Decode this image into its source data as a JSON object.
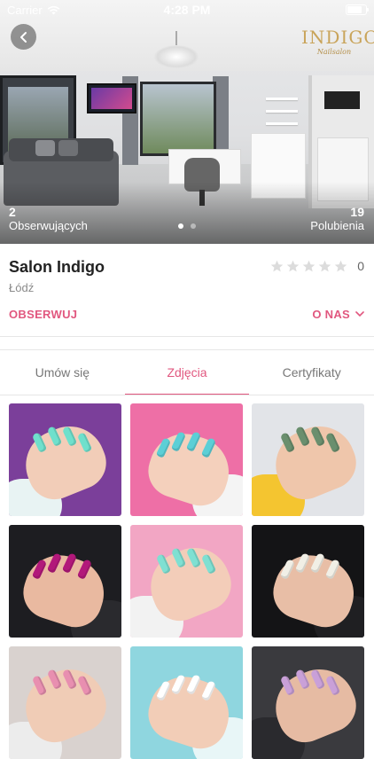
{
  "status_bar": {
    "carrier": "Carrier",
    "time": "4:28 PM",
    "battery_level": 0.9
  },
  "hero": {
    "followers_count": "2",
    "followers_label": "Obserwujących",
    "likes_count": "19",
    "likes_label": "Polubienia",
    "logo_text": "INDIGO",
    "logo_sub": "Nailsalon",
    "page_count": 2,
    "active_page": 1
  },
  "salon": {
    "name": "Salon Indigo",
    "city": "Łódź",
    "rating_value": 0,
    "rating_max": 5,
    "rating_count": "0"
  },
  "actions": {
    "follow_label": "OBSERWUJ",
    "about_label": "O NAS"
  },
  "tabs": [
    {
      "label": "Umów się",
      "active": false
    },
    {
      "label": "Zdjęcia",
      "active": true
    },
    {
      "label": "Certyfikaty",
      "active": false
    }
  ],
  "colors": {
    "accent": "#e1577f",
    "star_empty": "#dcdcdc"
  },
  "gallery": [
    {
      "bg": "#7b3f9a",
      "skin": "#f2cdb8",
      "nail": "#6fe0cc",
      "sleeve": "#e8f3f3"
    },
    {
      "bg": "#ee6fa6",
      "skin": "#f4d0bc",
      "nail": "#5ccfd6",
      "sleeve": "#f4f4f4"
    },
    {
      "bg": "#e2e4e8",
      "skin": "#efc6ab",
      "nail": "#6a8f6e",
      "sleeve": "#f4c530"
    },
    {
      "bg": "#1d1d21",
      "skin": "#e9b9a0",
      "nail": "#b2187a",
      "sleeve": "#2a2a2e"
    },
    {
      "bg": "#f2a6c4",
      "skin": "#f3cdb9",
      "nail": "#7fe0d2",
      "sleeve": "#f2f2f2"
    },
    {
      "bg": "#141416",
      "skin": "#e8bea6",
      "nail": "#f1efe6",
      "sleeve": "#1f1f22"
    },
    {
      "bg": "#d9d2cf",
      "skin": "#f0ccb6",
      "nail": "#e88fb0",
      "sleeve": "#ececec"
    },
    {
      "bg": "#8fd6df",
      "skin": "#f2cdb7",
      "nail": "#ffffff",
      "sleeve": "#e8f6f7"
    },
    {
      "bg": "#3a3a3e",
      "skin": "#e6bba3",
      "nail": "#c9a0d8",
      "sleeve": "#2a2a2e"
    }
  ]
}
